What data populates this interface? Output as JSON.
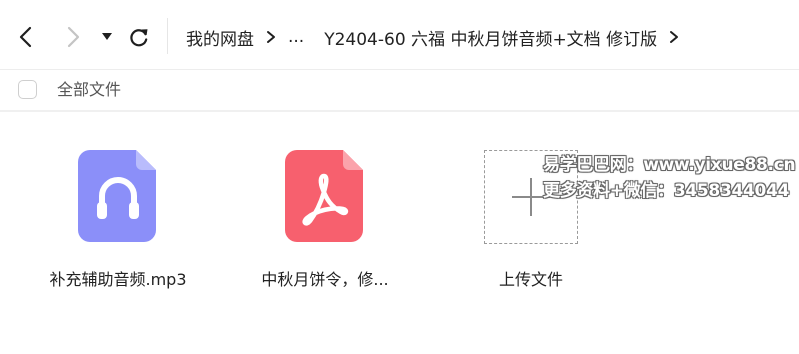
{
  "toolbar": {
    "back_icon": "chevron-left-icon",
    "forward_icon": "chevron-right-icon",
    "dropdown_icon": "caret-down-icon",
    "refresh_icon": "refresh-icon"
  },
  "breadcrumb": {
    "root": "我的网盘",
    "ellipsis": "...",
    "current": "Y2404-60 六福 中秋月饼音频+文档 修订版"
  },
  "selection": {
    "all_files_label": "全部文件"
  },
  "files": [
    {
      "name": "补充辅助音频.mp3",
      "type": "audio",
      "color": "#8b8ff9"
    },
    {
      "name": "中秋月饼令，修...",
      "type": "pdf",
      "color": "#f7606e"
    }
  ],
  "upload": {
    "label": "上传文件"
  },
  "watermark": {
    "line1": "易学巴巴网：www.yixue88.cn",
    "line2": "更多资料+微信：3458344044"
  }
}
